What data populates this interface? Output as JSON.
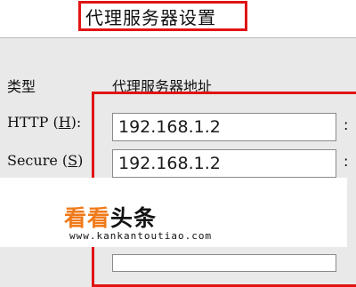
{
  "dialog": {
    "title": "代理服务器设置"
  },
  "columns": {
    "type_header": "类型",
    "address_header": "代理服务器地址"
  },
  "rows": [
    {
      "label_pre": "HTTP (",
      "label_key": "H",
      "label_post": "):",
      "address": "192.168.1.2",
      "sep": ":"
    },
    {
      "label_pre": "Secure (",
      "label_key": "S",
      "label_post": ")",
      "address": "192.168.1.2",
      "sep": ":"
    }
  ],
  "watermark": {
    "part1": "看看",
    "part2": "头条",
    "url": "www.kankantoutiao.com",
    "color_part1": "#f07a1a",
    "color_part2": "#111111"
  },
  "colors": {
    "highlight": "#e01414"
  }
}
